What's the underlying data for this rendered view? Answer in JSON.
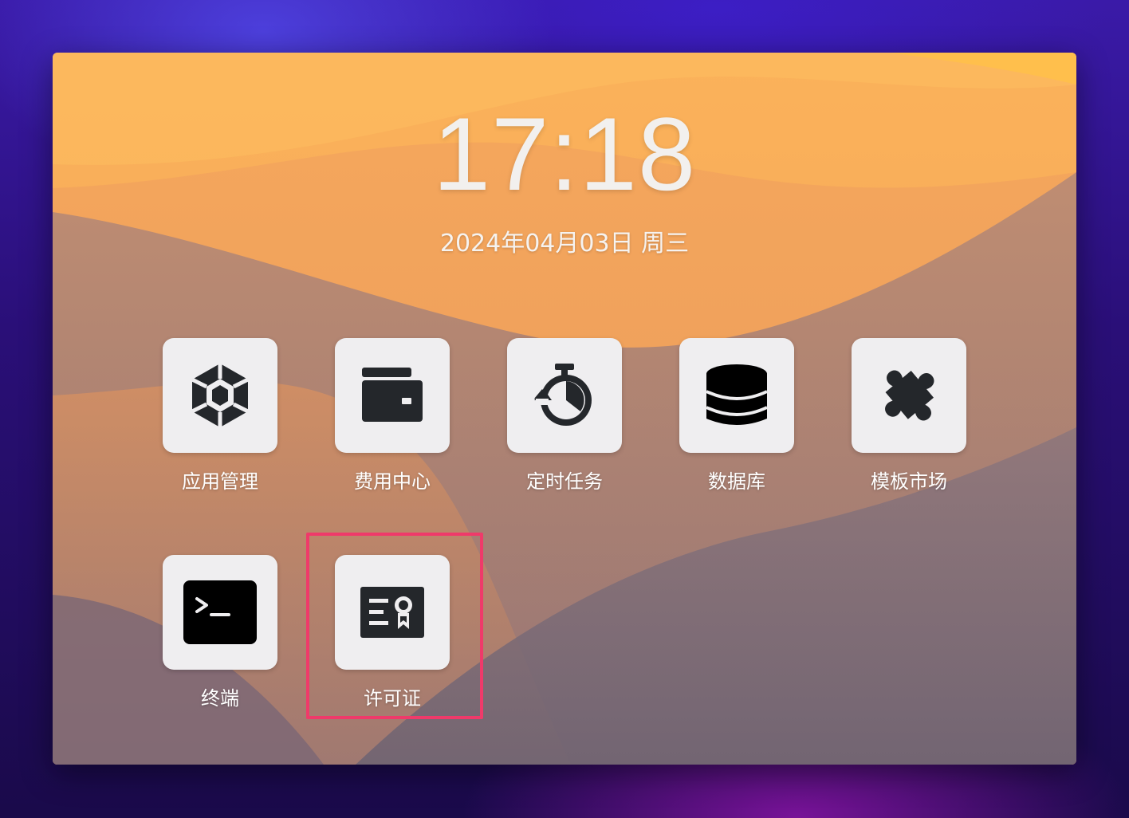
{
  "lockscreen": {
    "time": "17:18",
    "date": "2024年04月03日 周三"
  },
  "apps": [
    {
      "label": "应用管理",
      "icon": "app-management-icon"
    },
    {
      "label": "费用中心",
      "icon": "wallet-icon"
    },
    {
      "label": "定时任务",
      "icon": "stopwatch-icon"
    },
    {
      "label": "数据库",
      "icon": "database-icon"
    },
    {
      "label": "模板市场",
      "icon": "puzzle-piece-icon"
    },
    {
      "label": "终端",
      "icon": "terminal-icon"
    },
    {
      "label": "许可证",
      "icon": "license-certificate-icon"
    }
  ],
  "highlighted_app": "许可证",
  "colors": {
    "highlight_border": "#ef3a6a",
    "tile_bg": "#efeef0",
    "icon_dark": "#24272b"
  }
}
